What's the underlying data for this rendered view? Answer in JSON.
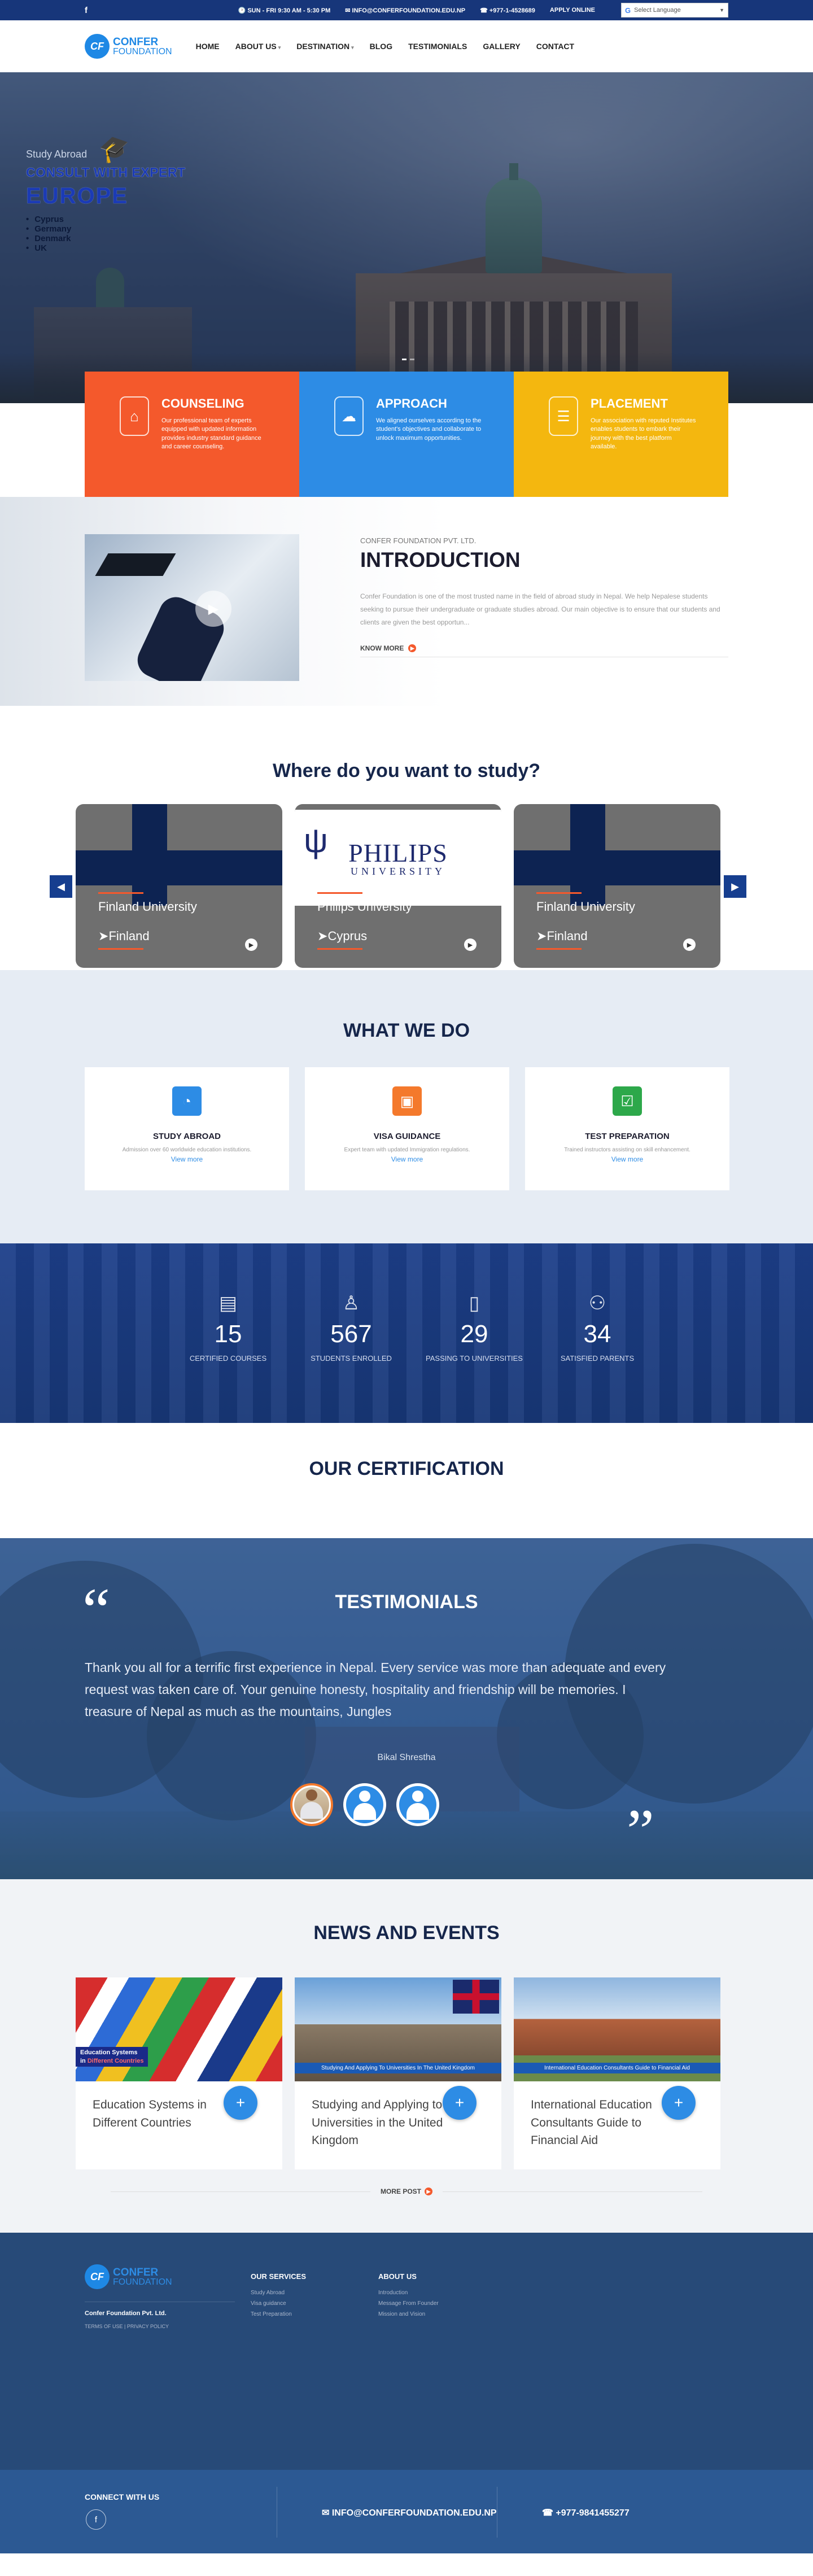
{
  "topbar": {
    "hours": "SUN - FRI 9:30 AM - 5:30 PM",
    "email": "INFO@CONFERFOUNDATION.EDU.NP",
    "phone": "+977-1-4528689",
    "apply": "APPLY ONLINE"
  },
  "logo": {
    "line1": "CONFER",
    "line2": "FOUNDATION",
    "mark": "CF"
  },
  "nav": [
    "HOME",
    "ABOUT US",
    "DESTINATION",
    "BLOG",
    "TESTIMONIALS",
    "GALLERY",
    "CONTACT"
  ],
  "hero": {
    "kicker": "Study Abroad",
    "title": "CONSULT WITH EXPERT",
    "region": "EUROPE",
    "countries": [
      "Cyprus",
      "Germany",
      "Denmark",
      "UK"
    ]
  },
  "services": [
    {
      "title": "COUNSELING",
      "text": "Our professional team of experts equipped with updated information provides industry standard guidance and career counseling.",
      "color": "#f4592c"
    },
    {
      "title": "APPROACH",
      "text": "We aligned ourselves according to the student's objectives and collaborate to unlock maximum opportunities.",
      "color": "#2d8ce5"
    },
    {
      "title": "PLACEMENT",
      "text": "Our association with reputed Institutes enables students to embark their journey with the best platform available.",
      "color": "#f4b70f"
    }
  ],
  "intro": {
    "small": "CONFER FOUNDATION PVT. LTD.",
    "title": "INTRODUCTION",
    "text": "Confer Foundation is one of the most trusted name in the field of abroad study in Nepal. We help Nepalese students seeking to pursue their undergraduate or graduate studies abroad. Our main objective is to ensure that our students and clients are given the best opportun...",
    "more": "KNOW MORE"
  },
  "study": {
    "title": "Where do you want to study?",
    "cards": [
      {
        "name": "Finland University",
        "country": "Finland"
      },
      {
        "name": "Philips University",
        "country": "Cyprus",
        "brand1": "PHILIPS",
        "brand2": "UNIVERSITY"
      },
      {
        "name": "Finland University",
        "country": "Finland"
      }
    ]
  },
  "wwd": {
    "title": "WHAT WE DO",
    "cards": [
      {
        "title": "STUDY ABROAD",
        "text": "Admission over 60 worldwide education institutions.",
        "link": "View more",
        "color": "#2d8ce5"
      },
      {
        "title": "VISA GUIDANCE",
        "text": "Expert team with updated Immigration regulations.",
        "link": "View more",
        "color": "#f4792c"
      },
      {
        "title": "TEST PREPARATION",
        "text": "Trained instructors assisting on skill enhancement.",
        "link": "View more",
        "color": "#2da84a"
      }
    ]
  },
  "counter": [
    {
      "num": "15",
      "label": "CERTIFIED COURSES"
    },
    {
      "num": "567",
      "label": "STUDENTS ENROLLED"
    },
    {
      "num": "29",
      "label": "PASSING TO UNIVERSITIES"
    },
    {
      "num": "34",
      "label": "SATISFIED PARENTS"
    }
  ],
  "cert": {
    "title": "OUR CERTIFICATION"
  },
  "testimonials": {
    "title": "TESTIMONIALS",
    "quote": "Thank you all for a terrific first experience in Nepal. Every service was more than adequate and every request was taken care of. Your genuine honesty, hospitality and friendship will be memories. I treasure of Nepal as much as the mountains, Jungles",
    "author": "Bikal Shrestha"
  },
  "news": {
    "title": "NEWS AND EVENTS",
    "cards": [
      {
        "title": "Education Systems in Different Countries",
        "tag1": "Education Systems",
        "tag2_a": "in ",
        "tag2_b": "Different Countries"
      },
      {
        "title": "Studying and Applying to Universities in the United Kingdom",
        "tag": "Studying And Applying To Universities In The United Kingdom"
      },
      {
        "title": "International Education Consultants Guide to Financial Aid",
        "tag": "International Education Consultants Guide to Financial Aid"
      }
    ],
    "more": "MORE POST"
  },
  "footer": {
    "company": "Confer Foundation Pvt. Ltd.",
    "terms": "TERMS OF USE | PRIVACY POLICY",
    "services_title": "OUR SERVICES",
    "services": [
      "Study Abroad",
      "Visa guidance",
      "Test Preparation"
    ],
    "about_title": "ABOUT US",
    "about": [
      "Introduction",
      "Message From Founder",
      "Mission and Vision"
    ],
    "connect": "CONNECT WITH US",
    "email": "INFO@CONFERFOUNDATION.EDU.NP",
    "phone": "+977-9841455277"
  },
  "translate": {
    "label": "Select Language"
  }
}
